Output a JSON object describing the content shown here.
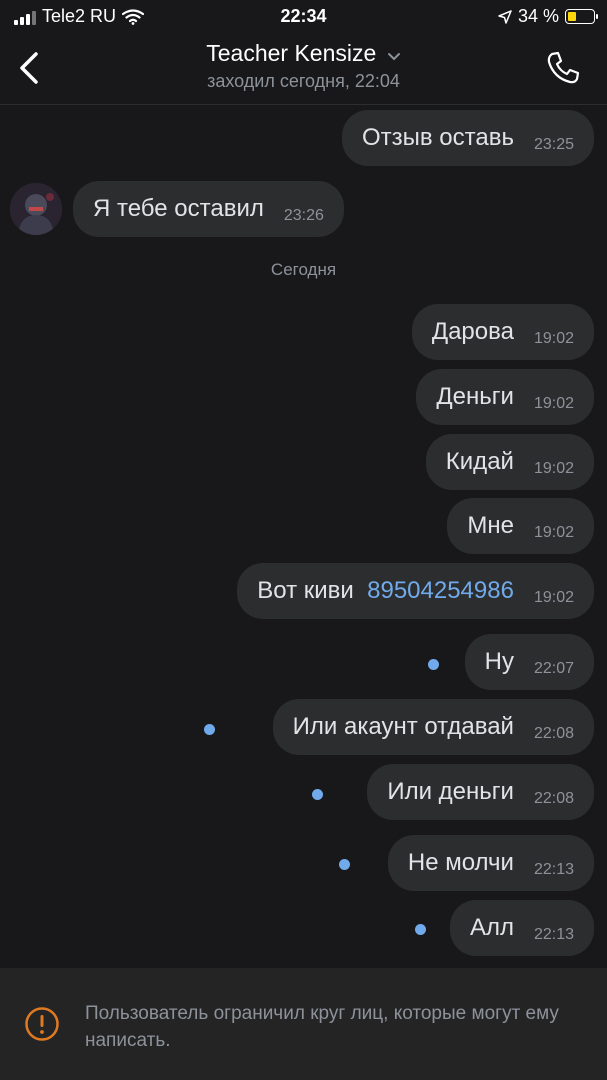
{
  "status_bar": {
    "carrier": "Tele2 RU",
    "time": "22:34",
    "battery": "34 %"
  },
  "header": {
    "title": "Teacher Kensize",
    "subtitle": "заходил сегодня, 22:04"
  },
  "date_separator": "Сегодня",
  "messages": [
    {
      "text": "Отзыв оставь",
      "time": "23:25",
      "direction": "out"
    },
    {
      "text": "Я тебе оставил",
      "time": "23:26",
      "direction": "in"
    },
    {
      "text": "Дарова",
      "time": "19:02",
      "direction": "out"
    },
    {
      "text": "Деньги",
      "time": "19:02",
      "direction": "out"
    },
    {
      "text": "Кидай",
      "time": "19:02",
      "direction": "out"
    },
    {
      "text": "Мне",
      "time": "19:02",
      "direction": "out"
    },
    {
      "text": "Вот киви ",
      "link": "89504254986",
      "time": "19:02",
      "direction": "out"
    },
    {
      "text": "Ну",
      "time": "22:07",
      "direction": "out",
      "unread": true
    },
    {
      "text": "Или акаунт отдавай",
      "time": "22:08",
      "direction": "out",
      "unread": true
    },
    {
      "text": "Или деньги",
      "time": "22:08",
      "direction": "out",
      "unread": true
    },
    {
      "text": "Не молчи",
      "time": "22:13",
      "direction": "out",
      "unread": true
    },
    {
      "text": "Алл",
      "time": "22:13",
      "direction": "out",
      "unread": true
    }
  ],
  "footer": {
    "notice": "Пользователь ограничил круг лиц, которые могут ему написать."
  },
  "colors": {
    "background": "#18181a",
    "bubble": "#2c2d2e",
    "accent": "#71aaeb",
    "warning": "#e07a22"
  }
}
